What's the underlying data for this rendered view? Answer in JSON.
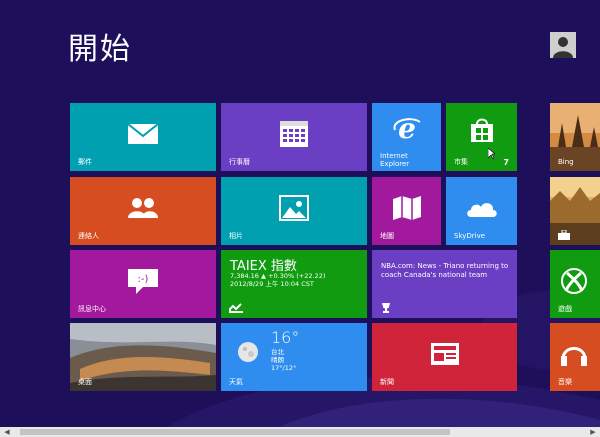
{
  "start": {
    "title": "開始"
  },
  "tiles": {
    "mail": {
      "label": "郵件"
    },
    "calendar": {
      "label": "行事曆"
    },
    "ie": {
      "label_line1": "Internet",
      "label_line2": "Explorer"
    },
    "store": {
      "label": "市集",
      "badge": "7"
    },
    "bing": {
      "label": "Bing"
    },
    "people": {
      "label": "連絡人"
    },
    "photos": {
      "label": "相片"
    },
    "maps": {
      "label": "地圖"
    },
    "skydrive": {
      "label": "SkyDrive"
    },
    "messaging": {
      "label": "訊息中心"
    },
    "finance": {
      "title": "TAIEX 指數",
      "line1": "7,384.16 ▲ +0.30% (+22.22)",
      "line2": "2012/8/29 上午 10:04 CST"
    },
    "news_sports": {
      "text": "NBA.com: News - Triano returning to coach Canada's national team"
    },
    "desktop": {
      "label": "桌面"
    },
    "weather": {
      "temp": "16°",
      "line1": "台北",
      "line2": "晴朗",
      "line3": "17°/12°",
      "label": "天氣"
    },
    "news": {
      "label": "新聞"
    },
    "games": {
      "label": "遊戲"
    },
    "music": {
      "label": "音樂"
    }
  },
  "colors": {
    "background": "#1e0f5a",
    "teal": "#00a0b1",
    "purple": "#6b3fc4",
    "blue": "#2e8def",
    "green": "#109b10",
    "orange": "#d54d20",
    "magenta": "#a2199e",
    "red": "#d0243a"
  }
}
